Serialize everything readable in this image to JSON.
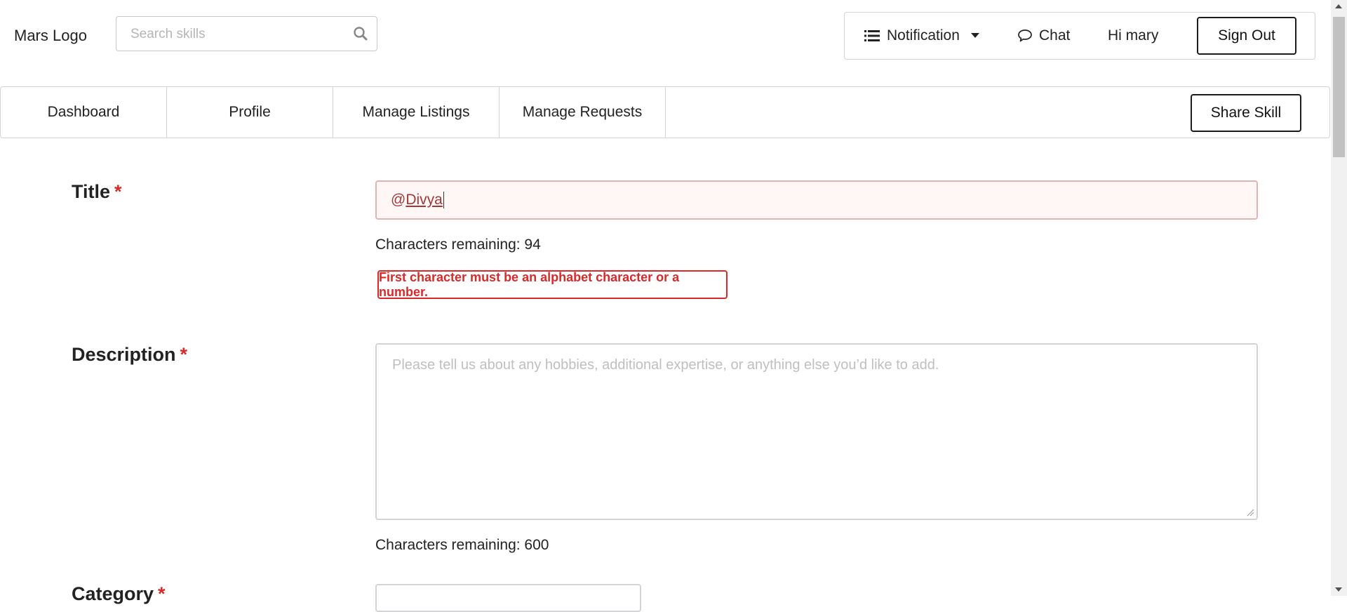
{
  "header": {
    "logo": "Mars Logo",
    "search_placeholder": "Search skills",
    "notification_label": "Notification",
    "chat_label": "Chat",
    "greeting": "Hi mary",
    "signout_label": "Sign Out"
  },
  "nav": {
    "items": [
      {
        "label": "Dashboard"
      },
      {
        "label": "Profile"
      },
      {
        "label": "Manage Listings"
      },
      {
        "label": "Manage Requests"
      }
    ],
    "share_label": "Share Skill"
  },
  "form": {
    "title": {
      "label": "Title",
      "required_mark": "*",
      "value_prefix": "@",
      "value_word": "Divya",
      "remaining": "Characters remaining: 94",
      "error": "First character must be an alphabet character or a number."
    },
    "description": {
      "label": "Description",
      "required_mark": "*",
      "placeholder": "Please tell us about any hobbies, additional expertise, or anything else you’d like to add.",
      "remaining": "Characters remaining: 600"
    },
    "category": {
      "label": "Category",
      "required_mark": "*"
    }
  },
  "colors": {
    "error_red": "#db2828",
    "error_bg": "#fff6f6",
    "error_border": "#e0b4b4",
    "border_gray": "#d4d4d6"
  }
}
